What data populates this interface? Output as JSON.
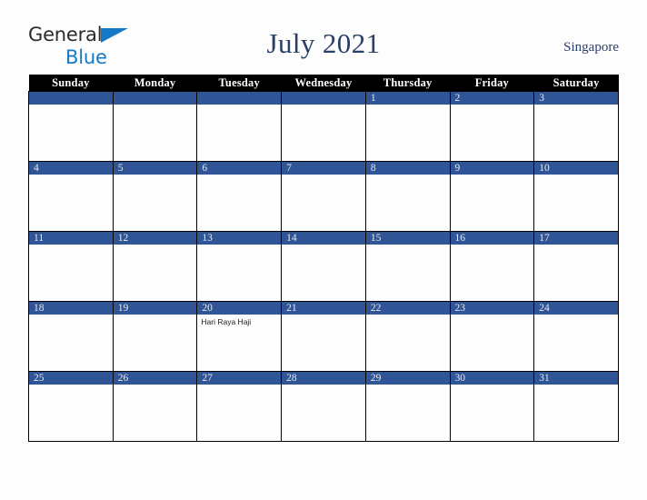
{
  "brand": {
    "name_part_one": "General",
    "name_part_two": "Blue",
    "triangle_icon": "triangle-icon",
    "color_dark": "#2b2b2b",
    "color_blue": "#1579c6"
  },
  "header": {
    "title": "July 2021",
    "month": "July",
    "year": "2021",
    "location": "Singapore",
    "title_color": "#2a3f66"
  },
  "calendar": {
    "header_background": "#000000",
    "header_text_color": "#ffffff",
    "date_banner_color": "#2f5596",
    "cell_background": "#fdfdfd",
    "border_color": "#000000",
    "weekdays": [
      "Sunday",
      "Monday",
      "Tuesday",
      "Wednesday",
      "Thursday",
      "Friday",
      "Saturday"
    ],
    "weeks": [
      [
        {
          "date": "",
          "event": ""
        },
        {
          "date": "",
          "event": ""
        },
        {
          "date": "",
          "event": ""
        },
        {
          "date": "",
          "event": ""
        },
        {
          "date": "1",
          "event": ""
        },
        {
          "date": "2",
          "event": ""
        },
        {
          "date": "3",
          "event": ""
        }
      ],
      [
        {
          "date": "4",
          "event": ""
        },
        {
          "date": "5",
          "event": ""
        },
        {
          "date": "6",
          "event": ""
        },
        {
          "date": "7",
          "event": ""
        },
        {
          "date": "8",
          "event": ""
        },
        {
          "date": "9",
          "event": ""
        },
        {
          "date": "10",
          "event": ""
        }
      ],
      [
        {
          "date": "11",
          "event": ""
        },
        {
          "date": "12",
          "event": ""
        },
        {
          "date": "13",
          "event": ""
        },
        {
          "date": "14",
          "event": ""
        },
        {
          "date": "15",
          "event": ""
        },
        {
          "date": "16",
          "event": ""
        },
        {
          "date": "17",
          "event": ""
        }
      ],
      [
        {
          "date": "18",
          "event": ""
        },
        {
          "date": "19",
          "event": ""
        },
        {
          "date": "20",
          "event": "Hari Raya Haji"
        },
        {
          "date": "21",
          "event": ""
        },
        {
          "date": "22",
          "event": ""
        },
        {
          "date": "23",
          "event": ""
        },
        {
          "date": "24",
          "event": ""
        }
      ],
      [
        {
          "date": "25",
          "event": ""
        },
        {
          "date": "26",
          "event": ""
        },
        {
          "date": "27",
          "event": ""
        },
        {
          "date": "28",
          "event": ""
        },
        {
          "date": "29",
          "event": ""
        },
        {
          "date": "30",
          "event": ""
        },
        {
          "date": "31",
          "event": ""
        }
      ]
    ]
  }
}
